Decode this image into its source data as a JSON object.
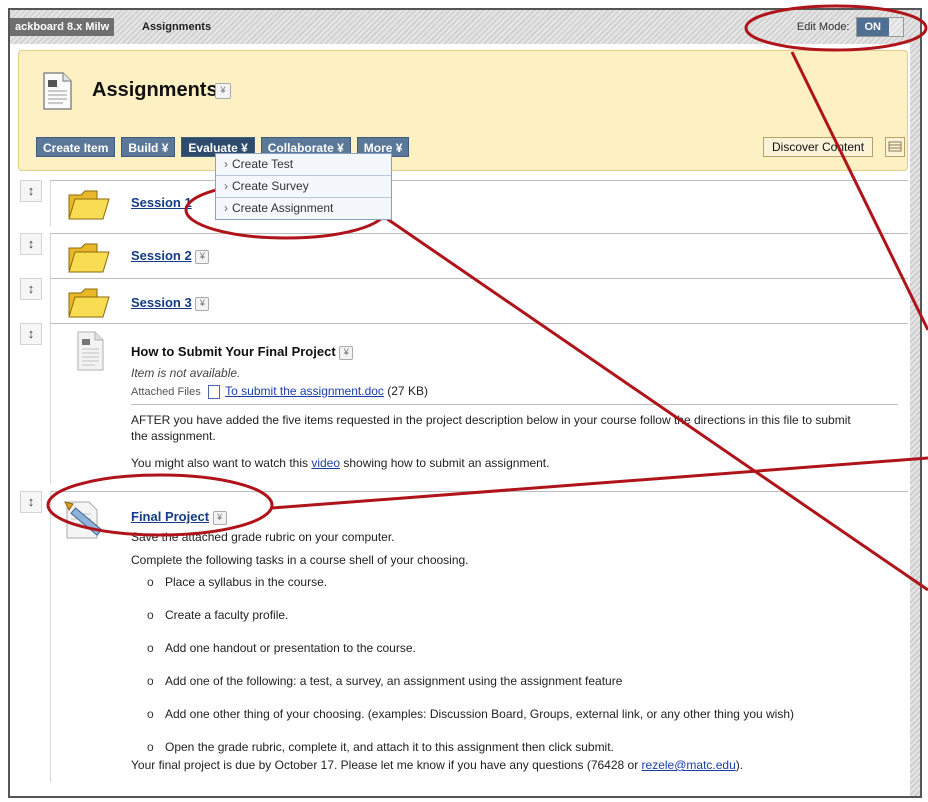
{
  "topbar": {
    "course_crumb": "ackboard 8.x Milw",
    "page_crumb": "Assignments",
    "edit_mode_label": "Edit Mode:",
    "edit_mode_value": "ON"
  },
  "header": {
    "title": "Assignments",
    "toolbar": {
      "create_item": "Create Item",
      "build": "Build",
      "evaluate": "Evaluate",
      "collaborate": "Collaborate",
      "more": "More",
      "discover": "Discover Content"
    }
  },
  "evaluate_menu": {
    "items": [
      "Create Test",
      "Create Survey",
      "Create Assignment"
    ]
  },
  "content_items": {
    "session1": "Session 1",
    "session2": "Session 2",
    "session3": "Session 3",
    "howto": {
      "title": "How to Submit Your Final Project",
      "availability": "Item is not available.",
      "attached_label": "Attached Files",
      "file_link": "To submit the assignment.doc",
      "file_size": "(27 KB)",
      "desc1": "AFTER you have added the five items requested in the project description below in your course follow the directions in this file to submit",
      "desc1b": "the assignment.",
      "desc2_pre": "You might also want to watch this ",
      "desc2_link": "video",
      "desc2_post": " showing how to submit an assignment."
    },
    "final": {
      "title": "Final Project",
      "line1": "Save the attached grade rubric on your computer.",
      "line2": "Complete the following tasks in a course shell of your choosing.",
      "tasks": [
        "Place a syllabus in the course.",
        "Create a faculty profile.",
        "Add one handout or presentation to the course.",
        "Add one of the following: a test, a survey, an assignment using the assignment feature",
        "Add one other thing of your choosing. (examples: Discussion Board, Groups, external link, or any other thing you wish)",
        "Open the grade rubric, complete it, and attach it to this assignment then click submit."
      ],
      "due_pre": "Your final project is due by October 17.  Please let me know if you have any questions (76428 or ",
      "due_email": "rezele@matc.edu",
      "due_post": ")."
    }
  },
  "colors": {
    "header_bg": "#fdf0c2",
    "button_bg": "#5b7898",
    "annotation": "#b0141b",
    "link": "#143c84"
  }
}
